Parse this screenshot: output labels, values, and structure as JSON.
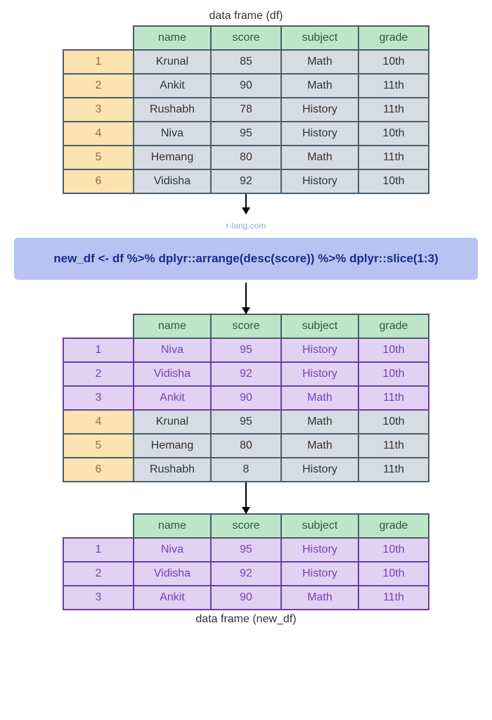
{
  "labels": {
    "top": "data frame (df)",
    "bottom": "data frame (new_df)",
    "watermark": "r-lang.com"
  },
  "columns": {
    "name": "name",
    "score": "score",
    "subject": "subject",
    "grade": "grade"
  },
  "code": "new_df <- df %>% dplyr::arrange(desc(score)) %>% dplyr::slice(1:3)",
  "table1": {
    "rows": [
      {
        "idx": "1",
        "name": "Krunal",
        "score": "85",
        "subject": "Math",
        "grade": "10th"
      },
      {
        "idx": "2",
        "name": "Ankit",
        "score": "90",
        "subject": "Math",
        "grade": "11th"
      },
      {
        "idx": "3",
        "name": "Rushabh",
        "score": "78",
        "subject": "History",
        "grade": "11th"
      },
      {
        "idx": "4",
        "name": "Niva",
        "score": "95",
        "subject": "History",
        "grade": "10th"
      },
      {
        "idx": "5",
        "name": "Hemang",
        "score": "80",
        "subject": "Math",
        "grade": "11th"
      },
      {
        "idx": "6",
        "name": "Vidisha",
        "score": "92",
        "subject": "History",
        "grade": "10th"
      }
    ]
  },
  "table2": {
    "rows": [
      {
        "idx": "1",
        "name": "Niva",
        "score": "95",
        "subject": "History",
        "grade": "10th",
        "highlight": true
      },
      {
        "idx": "2",
        "name": "Vidisha",
        "score": "92",
        "subject": "History",
        "grade": "10th",
        "highlight": true
      },
      {
        "idx": "3",
        "name": "Ankit",
        "score": "90",
        "subject": "Math",
        "grade": "11th",
        "highlight": true
      },
      {
        "idx": "4",
        "name": "Krunal",
        "score": "95",
        "subject": "Math",
        "grade": "10th",
        "highlight": false
      },
      {
        "idx": "5",
        "name": "Hemang",
        "score": "80",
        "subject": "Math",
        "grade": "11th",
        "highlight": false
      },
      {
        "idx": "6",
        "name": "Rushabh",
        "score": "8",
        "subject": "History",
        "grade": "11th",
        "highlight": false
      }
    ]
  },
  "table3": {
    "rows": [
      {
        "idx": "1",
        "name": "Niva",
        "score": "95",
        "subject": "History",
        "grade": "10th"
      },
      {
        "idx": "2",
        "name": "Vidisha",
        "score": "92",
        "subject": "History",
        "grade": "10th"
      },
      {
        "idx": "3",
        "name": "Ankit",
        "score": "90",
        "subject": "Math",
        "grade": "11th"
      }
    ]
  }
}
